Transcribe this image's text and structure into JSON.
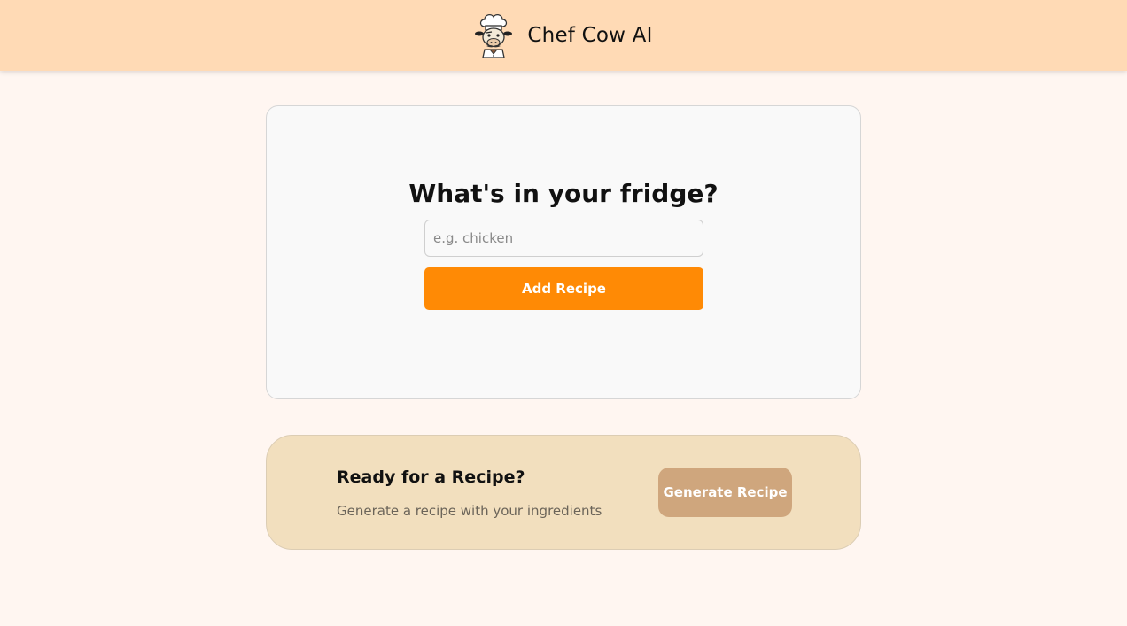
{
  "header": {
    "app_title": "Chef Cow AI",
    "logo_icon": "chef-cow-logo-icon",
    "background_color": "#ffdab5"
  },
  "fridge_card": {
    "heading": "What's in your fridge?",
    "input_placeholder": "e.g. chicken",
    "input_value": "",
    "add_button_label": "Add Recipe",
    "accent_color": "#ff8a05"
  },
  "ready_card": {
    "heading": "Ready for a Recipe?",
    "subtext": "Generate a recipe with your ingredients",
    "generate_button_label": "Generate Recipe",
    "button_color": "#cfa67d"
  }
}
